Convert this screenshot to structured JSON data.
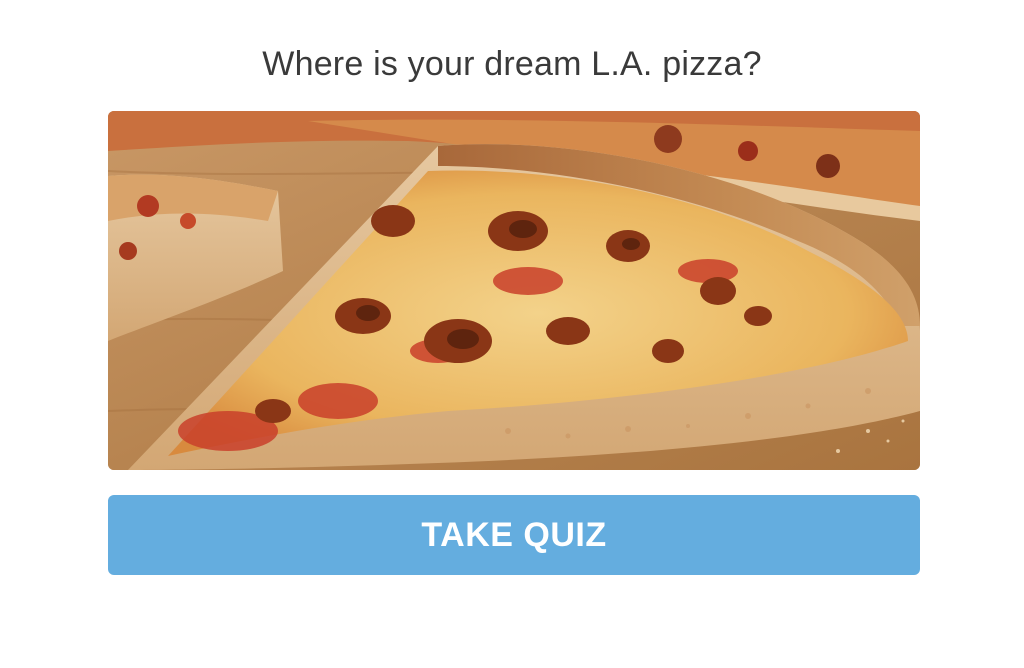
{
  "quiz": {
    "question": "Where is your dream L.A. pizza?",
    "cta_label": "TAKE QUIZ"
  },
  "hero_image": {
    "subject": "pizza-photo"
  },
  "colors": {
    "button_bg": "#64addf",
    "button_text": "#ffffff",
    "title_text": "#3a3a3a",
    "background": "#ffffff"
  }
}
